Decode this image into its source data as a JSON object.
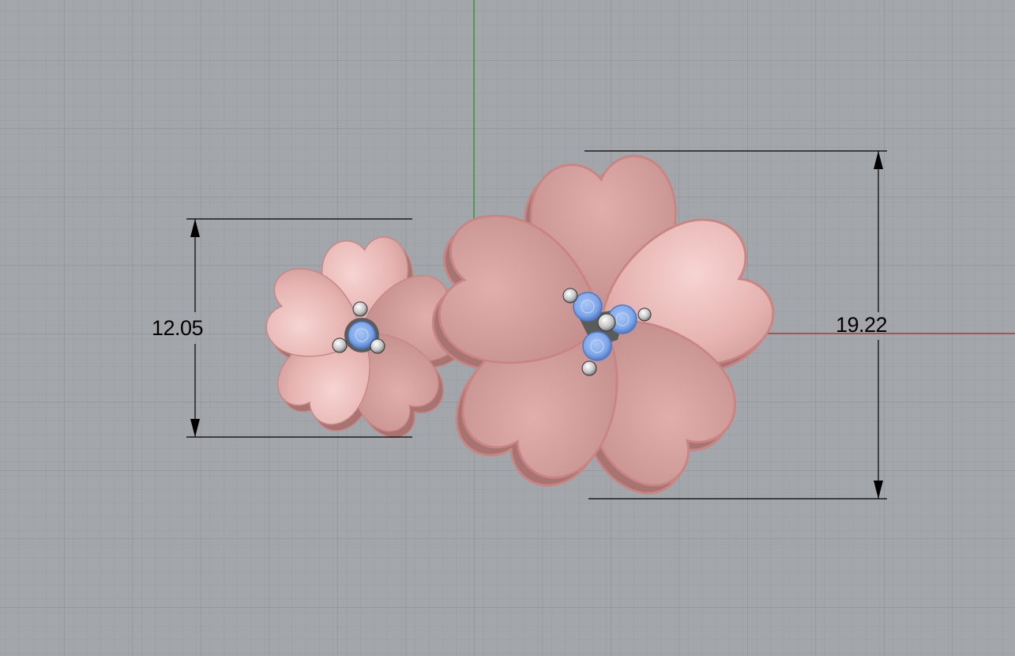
{
  "viewport": {
    "view": "Top",
    "background_color": "#a3a7ac",
    "grid_minor_color": "#989ca1",
    "grid_major_color": "#8d9196",
    "x_axis_color": "#b83232",
    "y_axis_color": "#2c9a2c",
    "grid_visible": true
  },
  "model": {
    "object": "flower-ring",
    "metal_color": "#e9b8b6",
    "metal_edge_color": "#c98583",
    "band_color": "#d96f6f",
    "gem_color": "#7ea6e8",
    "prong_color": "#c9c9c9",
    "icons": [
      "small-flower-icon",
      "large-flower-icon",
      "gemstone-icon",
      "prong-icon"
    ]
  },
  "dimensions": {
    "small_flower_height": "12.05",
    "large_flower_height": "19.22",
    "line_color": "#000000"
  }
}
